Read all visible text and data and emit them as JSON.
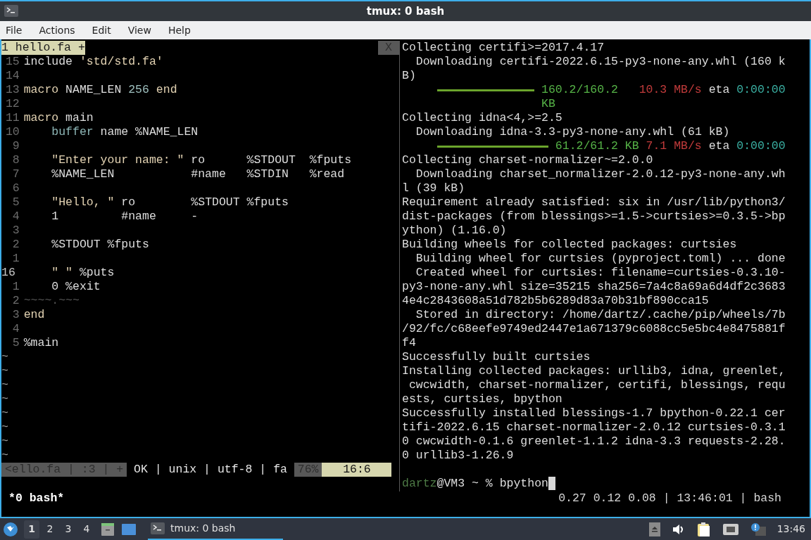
{
  "window": {
    "title": "tmux: 0 bash"
  },
  "menu": [
    "File",
    "Actions",
    "Edit",
    "View",
    "Help"
  ],
  "editor": {
    "tabs": [
      {
        "label": "1 hello.fa +",
        "selected": true
      }
    ],
    "close_label": "X",
    "lines": [
      {
        "number": "15",
        "current": false,
        "segments": [
          {
            "text": "include ",
            "kind": "plain"
          },
          {
            "text": "'std/std.fa'",
            "kind": "string"
          }
        ]
      },
      {
        "number": "14",
        "current": false
      },
      {
        "number": "13",
        "current": false,
        "segments": [
          {
            "text": "macro ",
            "kind": "keyword"
          },
          {
            "text": "NAME_LEN ",
            "kind": "plain"
          },
          {
            "text": "256 ",
            "kind": "number"
          },
          {
            "text": "end",
            "kind": "keyword"
          }
        ]
      },
      {
        "number": "12",
        "current": false
      },
      {
        "number": "11",
        "current": false,
        "segments": [
          {
            "text": "macro ",
            "kind": "keyword"
          },
          {
            "text": "main",
            "kind": "plain"
          }
        ]
      },
      {
        "number": "10",
        "current": false,
        "segments": [
          {
            "text": "    buffer ",
            "kind": "type"
          },
          {
            "text": "name %NAME_LEN",
            "kind": "plain"
          }
        ]
      },
      {
        "number": "9",
        "current": false
      },
      {
        "number": "8",
        "current": false,
        "segments": [
          {
            "text": "    \"Enter your name: \" ",
            "kind": "string"
          },
          {
            "text": "ro      %STDOUT  %fputs",
            "kind": "plain"
          }
        ]
      },
      {
        "number": "7",
        "current": false,
        "segments": [
          {
            "text": "    %NAME_LEN           #name   %STDIN   %read",
            "kind": "plain"
          }
        ]
      },
      {
        "number": "6",
        "current": false
      },
      {
        "number": "5",
        "current": false,
        "segments": [
          {
            "text": "    \"Hello, \" ",
            "kind": "string"
          },
          {
            "text": "ro        %STDOUT %fputs",
            "kind": "plain"
          }
        ]
      },
      {
        "number": "4",
        "current": false,
        "segments": [
          {
            "text": "    1         #name     -",
            "kind": "plain"
          }
        ]
      },
      {
        "number": "3",
        "current": false
      },
      {
        "number": "2",
        "current": false,
        "segments": [
          {
            "text": "    %STDOUT %fputs",
            "kind": "plain"
          }
        ]
      },
      {
        "number": "1",
        "current": false
      },
      {
        "number": "16",
        "current": true,
        "segments": [
          {
            "text": "    \" \" ",
            "kind": "string"
          },
          {
            "text": "%puts",
            "kind": "plain"
          }
        ]
      },
      {
        "number": "1",
        "current": false,
        "segments": [
          {
            "text": "    0 %exit",
            "kind": "plain"
          }
        ]
      },
      {
        "number": "2",
        "current": false,
        "segments": [
          {
            "text": "~~~~.~~~",
            "kind": "dim"
          }
        ]
      },
      {
        "number": "3",
        "current": false,
        "segments": [
          {
            "text": "end",
            "kind": "keyword"
          }
        ]
      },
      {
        "number": "4",
        "current": false
      },
      {
        "number": "5",
        "current": false,
        "segments": [
          {
            "text": "%main",
            "kind": "plain"
          }
        ]
      }
    ],
    "filler": [
      "~",
      "~",
      "~",
      "~",
      "~",
      "~",
      "~",
      "~"
    ],
    "status_line": [
      {
        "text": "<ello.fa | :3 | +",
        "kind": "inactive"
      },
      {
        "text": "OK | unix | utf-8 | fa",
        "kind": "plain"
      },
      {
        "text": "76%",
        "kind": "inactive"
      },
      {
        "text": "16:6",
        "kind": "position"
      }
    ]
  },
  "terminal": {
    "lines": [
      {
        "segments": [
          {
            "text": "Collecting certifi>=2017.4.17",
            "kind": "plain"
          }
        ]
      },
      {
        "segments": [
          {
            "text": "  Downloading certifi-2022.6.15-py3-none-any.whl (160 k",
            "kind": "plain"
          }
        ]
      },
      {
        "segments": [
          {
            "text": "B)",
            "kind": "plain"
          }
        ]
      },
      {
        "segments": [
          {
            "kind": "bar",
            "level": 1
          },
          {
            "text": " 160.2/160.2   ",
            "kind": "green"
          },
          {
            "text": "10.3 MB/s",
            "kind": "red"
          },
          {
            "text": " eta ",
            "kind": "plain"
          },
          {
            "text": "0:00:00",
            "kind": "teal"
          }
        ]
      },
      {
        "segments": [
          {
            "text": "                    KB",
            "kind": "green"
          }
        ]
      },
      {
        "segments": [
          {
            "text": "Collecting idna<4,>=2.5",
            "kind": "plain"
          }
        ]
      },
      {
        "segments": [
          {
            "text": "  Downloading idna-3.3-py3-none-any.whl (61 kB)",
            "kind": "plain"
          }
        ]
      },
      {
        "segments": [
          {
            "kind": "bar",
            "level": 1
          },
          {
            "text": " 61.2/61.2 KB ",
            "kind": "green"
          },
          {
            "text": "7.1 MB/s",
            "kind": "red"
          },
          {
            "text": " eta ",
            "kind": "plain"
          },
          {
            "text": "0:00:00",
            "kind": "teal"
          }
        ]
      },
      {
        "segments": [
          {
            "text": "Collecting charset-normalizer~=2.0.0",
            "kind": "plain"
          }
        ]
      },
      {
        "segments": [
          {
            "text": "  Downloading charset_normalizer-2.0.12-py3-none-any.wh",
            "kind": "plain"
          }
        ]
      },
      {
        "segments": [
          {
            "text": "l (39 kB)",
            "kind": "plain"
          }
        ]
      },
      {
        "segments": [
          {
            "text": "Requirement already satisfied: six in /usr/lib/python3/",
            "kind": "plain"
          }
        ]
      },
      {
        "segments": [
          {
            "text": "dist-packages (from blessings>=1.5->curtsies>=0.3.5->bp",
            "kind": "plain"
          }
        ]
      },
      {
        "segments": [
          {
            "text": "ython) (1.16.0)",
            "kind": "plain"
          }
        ]
      },
      {
        "segments": [
          {
            "text": "Building wheels for collected packages: curtsies",
            "kind": "plain"
          }
        ]
      },
      {
        "segments": [
          {
            "text": "  Building wheel for curtsies (pyproject.toml) ... done",
            "kind": "plain"
          }
        ]
      },
      {
        "segments": [
          {
            "text": "  Created wheel for curtsies: filename=curtsies-0.3.10-",
            "kind": "plain"
          }
        ]
      },
      {
        "segments": [
          {
            "text": "py3-none-any.whl size=35215 sha256=7a4c8a69a6d4df2c3683",
            "kind": "plain"
          }
        ]
      },
      {
        "segments": [
          {
            "text": "4e4c2843608a51d782b5b6289d83a70b31bf890cca15",
            "kind": "plain"
          }
        ]
      },
      {
        "segments": [
          {
            "text": "  Stored in directory: /home/dartz/.cache/pip/wheels/7b",
            "kind": "plain"
          }
        ]
      },
      {
        "segments": [
          {
            "text": "/92/fc/c68eefe9749ed2447e1a671379c6088cc5e5bc4e8475881f",
            "kind": "plain"
          }
        ]
      },
      {
        "segments": [
          {
            "text": "f4",
            "kind": "plain"
          }
        ]
      },
      {
        "segments": [
          {
            "text": "Successfully built curtsies",
            "kind": "plain"
          }
        ]
      },
      {
        "segments": [
          {
            "text": "Installing collected packages: urllib3, idna, greenlet,",
            "kind": "plain"
          }
        ]
      },
      {
        "segments": [
          {
            "text": " cwcwidth, charset-normalizer, certifi, blessings, requ",
            "kind": "plain"
          }
        ]
      },
      {
        "segments": [
          {
            "text": "ests, curtsies, bpython",
            "kind": "plain"
          }
        ]
      },
      {
        "segments": [
          {
            "text": "Successfully installed blessings-1.7 bpython-0.22.1 cer",
            "kind": "plain"
          }
        ]
      },
      {
        "segments": [
          {
            "text": "tifi-2022.6.15 charset-normalizer-2.0.12 curtsies-0.3.1",
            "kind": "plain"
          }
        ]
      },
      {
        "segments": [
          {
            "text": "0 cwcwidth-0.1.6 greenlet-1.1.2 idna-3.3 requests-2.28.",
            "kind": "plain"
          }
        ]
      },
      {
        "segments": [
          {
            "text": "0 urllib3-1.26.9",
            "kind": "plain"
          }
        ]
      },
      {
        "kind": "prompt",
        "segments": [
          {
            "text": "dartz",
            "kind": "user"
          },
          {
            "text": "@VM3 ~ % bpython",
            "kind": "plain"
          }
        ],
        "cursor": true
      }
    ]
  },
  "tmux_status": {
    "left": "*0 bash*",
    "right": "0.27 0.12 0.08 | 13:46:01 | bash"
  },
  "taskbar": {
    "workspaces": [
      {
        "label": "1",
        "selected": true
      },
      {
        "label": "2",
        "selected": false
      },
      {
        "label": "3",
        "selected": false
      },
      {
        "label": "4",
        "selected": false
      }
    ],
    "tasks": [
      {
        "label": "tmux: 0 bash",
        "selected": true
      }
    ],
    "clock": "13:46"
  }
}
